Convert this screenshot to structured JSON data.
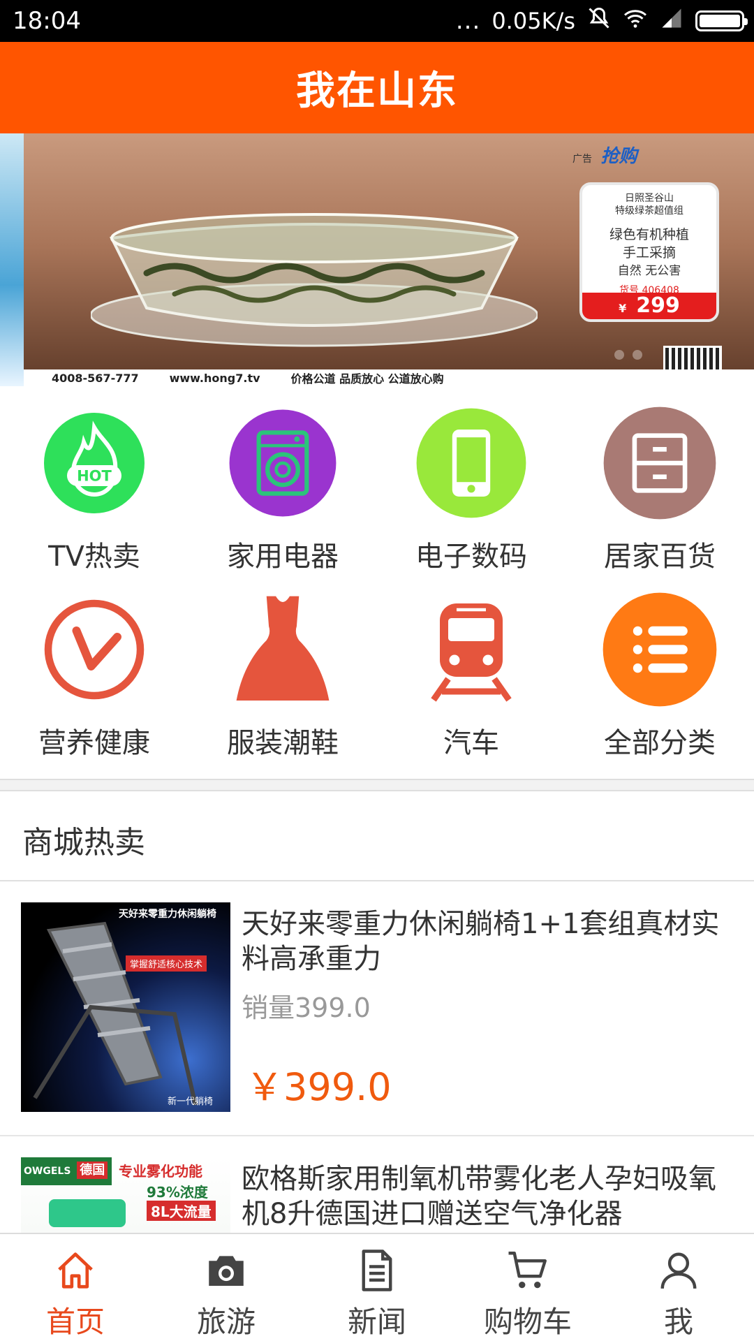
{
  "status_bar": {
    "time": "18:04",
    "dots": "...",
    "network_speed": "0.05K/s",
    "icons": [
      "mute-icon",
      "wifi-icon",
      "signal-icon",
      "battery-icon"
    ],
    "battery_level": 1.0
  },
  "header": {
    "title": "我在山东"
  },
  "banner": {
    "ad_label": "广告",
    "brand": "抢购",
    "card_lines": [
      "日照圣谷山",
      "特级绿茶超值组"
    ],
    "card_features": [
      "绿色有机种植",
      "手工采摘",
      "自然 无公害"
    ],
    "item_no": "货号 406408",
    "price_symbol": "¥",
    "price": "299",
    "phone": "4008-567-777",
    "url": "www.hong7.tv",
    "slogan": "价格公道  品质放心  公道放心购",
    "slide_count": 2
  },
  "categories": [
    {
      "label": "TV热卖",
      "icon": "hot-fire-icon",
      "color": "#2ee05a"
    },
    {
      "label": "家用电器",
      "icon": "washing-machine-icon",
      "color": "#9a34cf"
    },
    {
      "label": "电子数码",
      "icon": "phone-icon",
      "color": "#99e83b"
    },
    {
      "label": "居家百货",
      "icon": "cabinet-icon",
      "color": "#a97a74"
    },
    {
      "label": "营养健康",
      "icon": "health-check-icon",
      "color": "#e5553d"
    },
    {
      "label": "服装潮鞋",
      "icon": "dress-icon",
      "color": "#e5553d"
    },
    {
      "label": "汽车",
      "icon": "train-icon",
      "color": "#e5553d"
    },
    {
      "label": "全部分类",
      "icon": "list-icon",
      "color": "#ff7a14"
    }
  ],
  "section": {
    "title": "商城热卖"
  },
  "products": [
    {
      "name": "天好来零重力休闲躺椅1+1套组真材实料高承重力",
      "sales": "销量399.0",
      "price": "￥399.0",
      "thumb_text": [
        "天好来零重力休闲躺椅",
        "掌握舒适核心技术",
        "新一代躺椅"
      ]
    },
    {
      "name": "欧格斯家用制氧机带雾化老人孕妇吸氧机8升德国进口赠送空气净化器",
      "thumb_text": [
        "OWGELS",
        "德国",
        "专业雾化功能",
        "93%浓度",
        "8L大流量"
      ]
    }
  ],
  "bottom_nav": [
    {
      "label": "首页",
      "icon": "home-icon",
      "active": true
    },
    {
      "label": "旅游",
      "icon": "camera-icon",
      "active": false
    },
    {
      "label": "新闻",
      "icon": "news-icon",
      "active": false
    },
    {
      "label": "购物车",
      "icon": "cart-icon",
      "active": false
    },
    {
      "label": "我",
      "icon": "user-icon",
      "active": false
    }
  ],
  "colors": {
    "header": "#ff5500",
    "price": "#f05a0e",
    "active_nav": "#e8491d"
  }
}
